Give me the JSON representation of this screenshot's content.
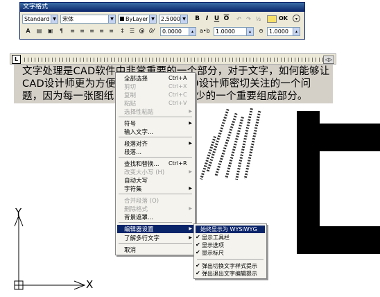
{
  "toolbar": {
    "title": "文字格式",
    "style_value": "Standard",
    "font_value": "宋体",
    "color_value": "ByLayer",
    "height_value": "2.5000",
    "bold": "B",
    "italic": "I",
    "underline": "U",
    "overline": "O",
    "ok": "OK",
    "oblique_value": "0.0000",
    "tracking_value": "1.0000",
    "width_value": "1.0000",
    "tracking_label": "a•b",
    "oblique_label": "0/"
  },
  "ruler": {
    "corner": "L"
  },
  "paragraph": {
    "line1": "文字处理是CAD软件中非常重要的一个部分，对于文字，如何能够让",
    "line2": "CAD设计师更为方便的处理文字是CAD设计师密切关注的一个问",
    "line3": "题，因为每一张图纸当中文字都是不可少的一个重要组成部分。"
  },
  "context_menu": {
    "items": [
      {
        "label": "全部选择",
        "shortcut": "Ctrl+A"
      },
      {
        "label": "剪切",
        "shortcut": "Ctrl+X"
      },
      {
        "label": "复制",
        "shortcut": "Ctrl+C"
      },
      {
        "label": "粘贴",
        "shortcut": "Ctrl+V"
      },
      {
        "label": "选择性粘贴"
      },
      {
        "label": "符号"
      },
      {
        "label": "输入文字..."
      },
      {
        "label": "段落对齐"
      },
      {
        "label": "段落..."
      },
      {
        "label": "查找和替换...",
        "shortcut": "Ctrl+R"
      },
      {
        "label": "改变大小写 (H)"
      },
      {
        "label": "自动大写"
      },
      {
        "label": "字符集"
      },
      {
        "label": "合并段落 (O)"
      },
      {
        "label": "删除格式"
      },
      {
        "label": "背景遮罩..."
      },
      {
        "label": "编辑器设置"
      },
      {
        "label": "了解多行文字"
      },
      {
        "label": "取消"
      }
    ]
  },
  "submenu": {
    "items": [
      {
        "label": "始终显示为 WYSIWYG"
      },
      {
        "label": "显示工具栏",
        "check": "✔"
      },
      {
        "label": "显示选项",
        "check": "✔"
      },
      {
        "label": "显示标尺",
        "check": "✔"
      },
      {
        "label": "弹出切换文字样式提示",
        "check": "✔"
      },
      {
        "label": "弹出退出文字编辑提示",
        "check": "✔"
      }
    ]
  },
  "ucs": {
    "y_label": "Y",
    "x_label": "X"
  },
  "colors": {
    "highlight": "#0a246a",
    "menu_bg": "#f4f3ee",
    "toolbar_bg": "#ece9d8"
  }
}
